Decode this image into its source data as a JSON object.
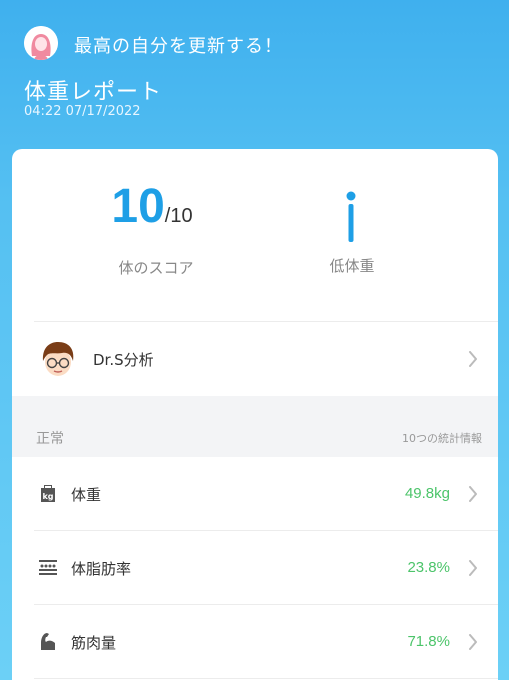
{
  "header": {
    "slogan": "最高の自分を更新する！",
    "title": "体重レポート",
    "timestamp": "04:22 07/17/2022",
    "avatar_icon": "female-avatar-icon"
  },
  "score": {
    "value": "10",
    "max": "/10",
    "label": "体のスコア",
    "color": "#1e9fe6"
  },
  "body_type": {
    "label": "低体重",
    "icon": "body-figure-icon"
  },
  "doctor": {
    "label": "Dr.S分析",
    "icon": "doctor-avatar-icon"
  },
  "section": {
    "title": "正常",
    "count": "10つの統計情報"
  },
  "metrics": [
    {
      "label": "体重",
      "value": "49.8kg",
      "icon": "weight-kg-icon"
    },
    {
      "label": "体脂肪率",
      "value": "23.8%",
      "icon": "body-fat-icon"
    },
    {
      "label": "筋肉量",
      "value": "71.8%",
      "icon": "muscle-icon"
    }
  ],
  "colors": {
    "accent": "#1e9fe6",
    "good": "#4cc46a",
    "background_top": "#3fb0ee",
    "background_bottom": "#6cd0f6"
  }
}
